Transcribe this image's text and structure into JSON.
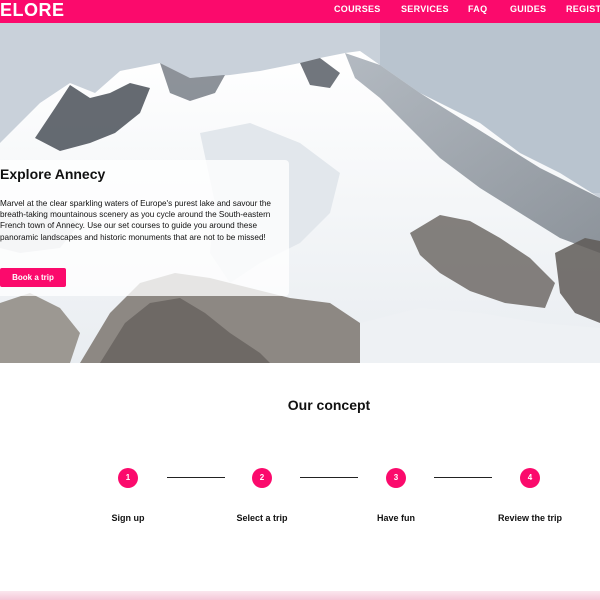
{
  "header": {
    "logo": "ELORE",
    "nav": [
      "COURSES",
      "SERVICES",
      "FAQ",
      "GUIDES",
      "REGISTE"
    ]
  },
  "hero": {
    "title": "Explore Annecy",
    "text": "Marvel at the clear sparkling waters of Europe's purest lake and savour the breath-taking mountainous scenery as you cycle around the South-eastern French town of Annecy. Use our set courses to guide you around these panoramic landscapes and historic monuments that are not to be missed!",
    "button_label": "Book a trip"
  },
  "concept": {
    "title": "Our concept",
    "steps": [
      {
        "number": "1",
        "label": "Sign up"
      },
      {
        "number": "2",
        "label": "Select a trip"
      },
      {
        "number": "3",
        "label": "Have fun"
      },
      {
        "number": "4",
        "label": "Review the trip"
      }
    ]
  },
  "colors": {
    "accent": "#fb0a6c",
    "header_bg": "#fb0a6c",
    "footer_strip": "#f5c6d7"
  }
}
